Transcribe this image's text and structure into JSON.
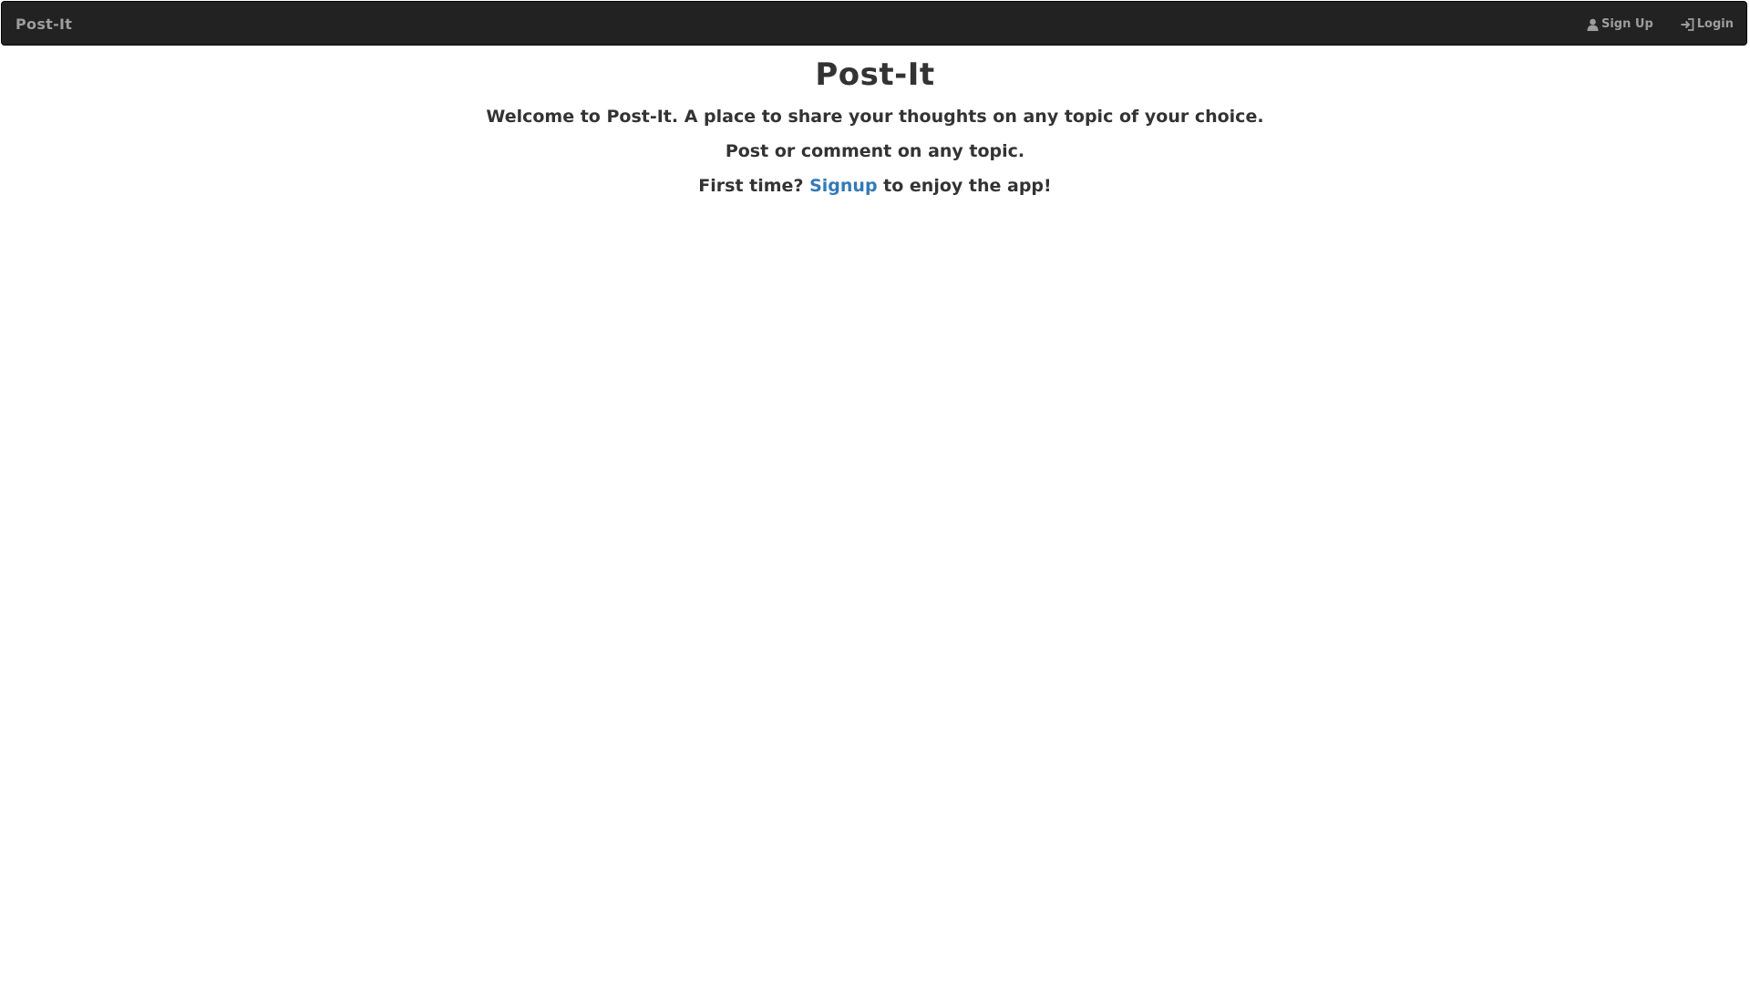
{
  "navbar": {
    "brand": "Post-It",
    "links": [
      {
        "label": "Sign Up",
        "icon": "user-icon"
      },
      {
        "label": "Login",
        "icon": "login-icon"
      }
    ]
  },
  "main": {
    "title": "Post-It",
    "welcome": "Welcome to Post-It. A place to share your thoughts on any topic of your choice.",
    "post_line": "Post or comment on any topic.",
    "first_time_prefix": "First time?",
    "signup_link": "Signup",
    "first_time_suffix": "to enjoy the app!"
  },
  "colors": {
    "navbar_bg": "#222222",
    "nav_text": "#9d9d9d",
    "text": "#333333",
    "link": "#337ab7"
  }
}
